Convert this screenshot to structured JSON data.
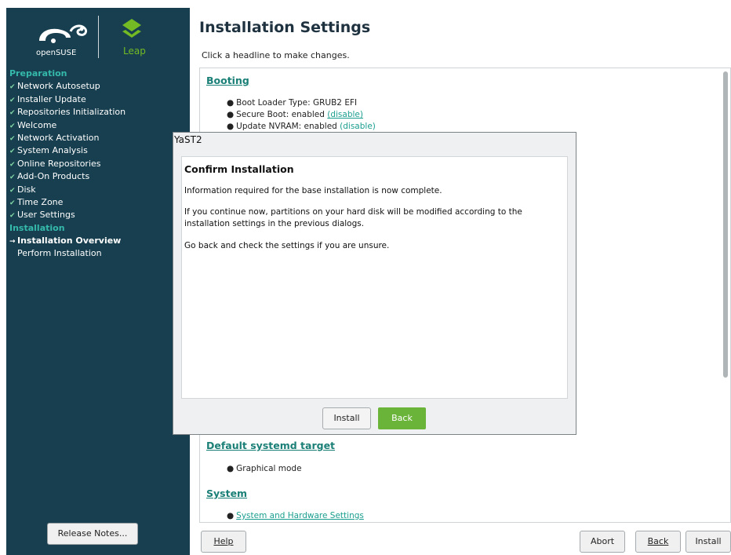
{
  "sidebar": {
    "brand_suse": "openSUSE",
    "brand_leap": "Leap",
    "steps": [
      {
        "type": "header",
        "label": "Preparation"
      },
      {
        "type": "done",
        "label": "Network Autosetup"
      },
      {
        "type": "done",
        "label": "Installer Update"
      },
      {
        "type": "done",
        "label": "Repositories Initialization"
      },
      {
        "type": "done",
        "label": "Welcome"
      },
      {
        "type": "done",
        "label": "Network Activation"
      },
      {
        "type": "done",
        "label": "System Analysis"
      },
      {
        "type": "done",
        "label": "Online Repositories"
      },
      {
        "type": "done",
        "label": "Add-On Products"
      },
      {
        "type": "done",
        "label": "Disk"
      },
      {
        "type": "done",
        "label": "Time Zone"
      },
      {
        "type": "done",
        "label": "User Settings"
      },
      {
        "type": "header",
        "label": "Installation"
      },
      {
        "type": "current",
        "label": "Installation Overview"
      },
      {
        "type": "pending",
        "label": "Perform Installation"
      }
    ],
    "release_notes": "Release Notes..."
  },
  "main": {
    "title": "Installation Settings",
    "hint": "Click a headline to make changes.",
    "booting": {
      "title": "Booting",
      "items": [
        {
          "text": "Boot Loader Type: GRUB2 EFI",
          "action": ""
        },
        {
          "text": "Secure Boot: enabled ",
          "action": "(disable)"
        },
        {
          "text": "Update NVRAM: enabled ",
          "action": "(disable)"
        }
      ]
    },
    "systemd": {
      "title": "Default systemd target",
      "items": [
        "Graphical mode"
      ]
    },
    "system": {
      "title": "System",
      "items": [
        "System and Hardware Settings"
      ]
    }
  },
  "footer": {
    "help": "Help",
    "abort": "Abort",
    "back": "Back",
    "install": "Install"
  },
  "dialog": {
    "window_title": "YaST2",
    "heading": "Confirm Installation",
    "para1": "Information required for the base installation is now complete.",
    "para2": "If you continue now, partitions on your hard disk will be modified according to the installation settings in the previous dialogs.",
    "para3": "Go back and check the settings if you are unsure.",
    "install_label": "Install",
    "back_label": "Back"
  },
  "colors": {
    "sidebar_bg": "#173f4f",
    "accent_green": "#73ba25",
    "header_teal": "#35b9ab",
    "link_teal": "#1a7f76",
    "back_button": "#6bb43a"
  }
}
